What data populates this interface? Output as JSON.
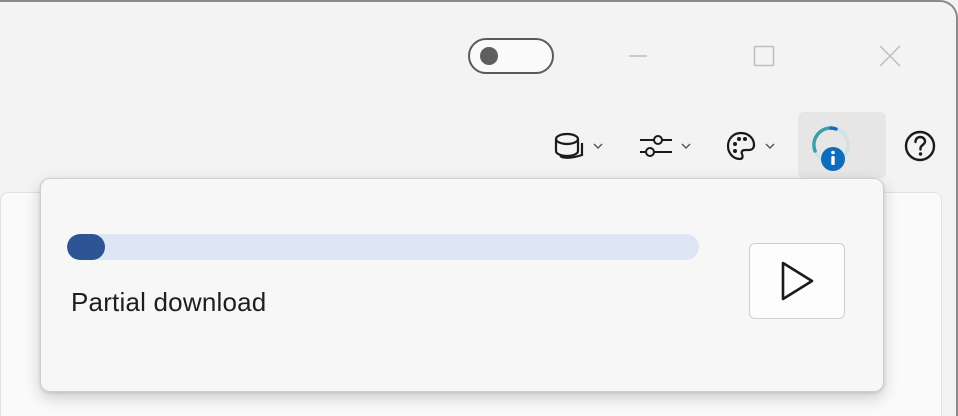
{
  "titlebar": {
    "toggle": {
      "state": "off"
    },
    "minimize_icon": "minimize-icon",
    "maximize_icon": "maximize-icon",
    "close_icon": "close-icon"
  },
  "toolbar": {
    "items": [
      {
        "icon": "database-icon",
        "has_dropdown": true
      },
      {
        "icon": "sliders-icon",
        "has_dropdown": true
      },
      {
        "icon": "palette-icon",
        "has_dropdown": true
      },
      {
        "icon": "download-status-info-icon",
        "has_dropdown": false
      },
      {
        "icon": "help-icon",
        "has_dropdown": false
      }
    ]
  },
  "download_flyout": {
    "progress": 0.06,
    "status_text": "Partial download",
    "play_icon": "play-icon"
  },
  "colors": {
    "accent_progress": "#2e5593",
    "progress_track": "#dce6f5",
    "info_blue": "#0f6cbd",
    "spinner_teal": "#3aa0a8"
  }
}
